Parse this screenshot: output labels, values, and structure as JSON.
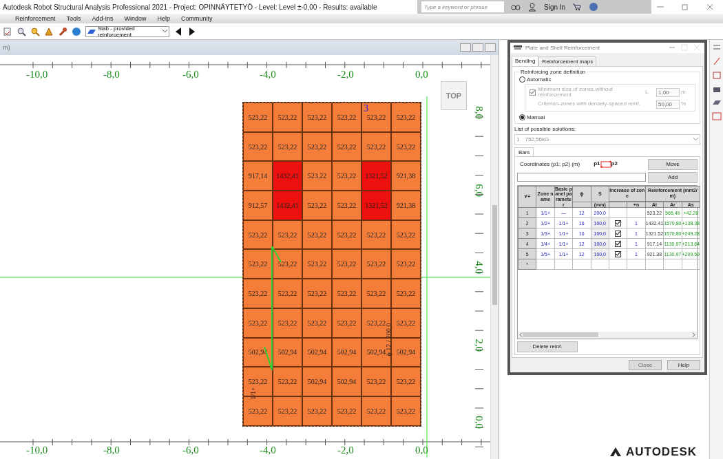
{
  "window": {
    "title": "Autodesk Robot Structural Analysis Professional 2021 - Project: OPINNÄYTETYÖ - Level: Level ±-0,00 - Results: available",
    "search_placeholder": "Type a keyword or phrase",
    "sign_in": "Sign In"
  },
  "menu": [
    "Reinforcement",
    "Tools",
    "Add-Ins",
    "Window",
    "Help",
    "Community"
  ],
  "toolbar": {
    "view_select": "Slab - provided reinforcement"
  },
  "canvas": {
    "title_fragment": "m)",
    "view_cube": "TOP",
    "marker": "3",
    "zone_label": "1/1+",
    "dimension_label": "ϕ 12 / 200,0",
    "top_axis": [
      "-10,0",
      "-8,0",
      "-6,0",
      "-4,0",
      "-2,0",
      "0,0"
    ],
    "bottom_axis": [
      "-10,0",
      "-8,0",
      "-6,0",
      "-4,0",
      "-2,0",
      "0,0"
    ],
    "right_axis": [
      "8,0",
      "6,0",
      "4,0",
      "2,0",
      "0,0"
    ],
    "rows": [
      [
        {
          "value": "523,22",
          "highlighted": false
        },
        {
          "value": "523,22",
          "highlighted": false
        },
        {
          "value": "523,22",
          "highlighted": false
        },
        {
          "value": "523,22",
          "highlighted": false
        },
        {
          "value": "523,22",
          "highlighted": false
        },
        {
          "value": "523,22",
          "highlighted": false
        }
      ],
      [
        {
          "value": "523,22",
          "highlighted": false
        },
        {
          "value": "523,22",
          "highlighted": false
        },
        {
          "value": "523,22",
          "highlighted": false
        },
        {
          "value": "523,22",
          "highlighted": false
        },
        {
          "value": "523,22",
          "highlighted": false
        },
        {
          "value": "523,22",
          "highlighted": false
        }
      ],
      [
        {
          "value": "917,14",
          "highlighted": false
        },
        {
          "value": "1432,41",
          "highlighted": true
        },
        {
          "value": "523,22",
          "highlighted": false
        },
        {
          "value": "523,22",
          "highlighted": false
        },
        {
          "value": "1321,52",
          "highlighted": true
        },
        {
          "value": "921,38",
          "highlighted": false
        }
      ],
      [
        {
          "value": "912,57",
          "highlighted": false
        },
        {
          "value": "1432,41",
          "highlighted": true
        },
        {
          "value": "523,22",
          "highlighted": false
        },
        {
          "value": "523,22",
          "highlighted": false
        },
        {
          "value": "1321,52",
          "highlighted": true
        },
        {
          "value": "921,38",
          "highlighted": false
        }
      ],
      [
        {
          "value": "523,22",
          "highlighted": false
        },
        {
          "value": "523,22",
          "highlighted": false
        },
        {
          "value": "523,22",
          "highlighted": false
        },
        {
          "value": "523,22",
          "highlighted": false
        },
        {
          "value": "523,22",
          "highlighted": false
        },
        {
          "value": "523,22",
          "highlighted": false
        }
      ],
      [
        {
          "value": "523,22",
          "highlighted": false
        },
        {
          "value": "523,22",
          "highlighted": false
        },
        {
          "value": "523,22",
          "highlighted": false
        },
        {
          "value": "523,22",
          "highlighted": false
        },
        {
          "value": "523,22",
          "highlighted": false
        },
        {
          "value": "523,22",
          "highlighted": false
        }
      ],
      [
        {
          "value": "523,22",
          "highlighted": false
        },
        {
          "value": "523,22",
          "highlighted": false
        },
        {
          "value": "523,22",
          "highlighted": false
        },
        {
          "value": "523,22",
          "highlighted": false
        },
        {
          "value": "523,22",
          "highlighted": false
        },
        {
          "value": "523,22",
          "highlighted": false
        }
      ],
      [
        {
          "value": "523,22",
          "highlighted": false
        },
        {
          "value": "523,22",
          "highlighted": false
        },
        {
          "value": "523,22",
          "highlighted": false
        },
        {
          "value": "523,22",
          "highlighted": false
        },
        {
          "value": "523,22",
          "highlighted": false
        },
        {
          "value": "523,22",
          "highlighted": false
        }
      ],
      [
        {
          "value": "502,94",
          "highlighted": false
        },
        {
          "value": "502,94",
          "highlighted": false
        },
        {
          "value": "502,94",
          "highlighted": false
        },
        {
          "value": "502,94",
          "highlighted": false
        },
        {
          "value": "502,94",
          "highlighted": false
        },
        {
          "value": "502,94",
          "highlighted": false
        }
      ],
      [
        {
          "value": "523,22",
          "highlighted": false
        },
        {
          "value": "523,22",
          "highlighted": false
        },
        {
          "value": "502,94",
          "highlighted": false
        },
        {
          "value": "502,94",
          "highlighted": false
        },
        {
          "value": "523,22",
          "highlighted": false
        },
        {
          "value": "523,22",
          "highlighted": false
        }
      ],
      [
        {
          "value": "523,22",
          "highlighted": false
        },
        {
          "value": "523,22",
          "highlighted": false
        },
        {
          "value": "523,22",
          "highlighted": false
        },
        {
          "value": "523,22",
          "highlighted": false
        },
        {
          "value": "523,22",
          "highlighted": false
        },
        {
          "value": "523,22",
          "highlighted": false
        }
      ]
    ]
  },
  "dialog": {
    "title": "Plate and Shell Reinforcement",
    "tabs": [
      {
        "label": "Bending",
        "selected": true
      },
      {
        "label": "Reinforcement maps",
        "selected": false
      }
    ],
    "zone_group": "Reinforcing zone definition",
    "automatic": {
      "label": "Automatic",
      "selected": false
    },
    "min_size": {
      "label": "Minimum size of zones without reinforcement",
      "checked": true,
      "symbol": "L",
      "value": "1,00",
      "unit": "m"
    },
    "criterion": {
      "label": "Criterion-zones with densely-spaced reinf.",
      "value": "50,00",
      "unit": "%"
    },
    "manual": {
      "label": "Manual",
      "selected": true
    },
    "solutions_label": "List of possible solutions:",
    "solution": {
      "index": "1",
      "value": "752,56kG"
    },
    "bars_tab": "Bars",
    "coords_label": "Coordinates (p1; p2) (m)",
    "p1": "p1",
    "p2": "p2",
    "move": "Move",
    "add": "Add",
    "table": {
      "head": {
        "num": "Y+",
        "zone": "Zone name",
        "basic": "Basic panel parameter",
        "phi": "ϕ",
        "s": "S",
        "increase": "Increase of zone",
        "reinf": "Reinforcement (mm2/m)",
        "s_unit": "(mm)",
        "n": "+n",
        "at": "At",
        "ar": "Ar",
        "as": "As"
      },
      "rows": [
        {
          "kind": "base",
          "num": "1",
          "zone": "1/1+",
          "basic": "—",
          "phi": "12",
          "s": "200,0",
          "n": "",
          "at": "523.22",
          "ar": "565,49",
          "as": "+42.26"
        },
        {
          "kind": "zone",
          "num": "2",
          "zone": "1/2+",
          "basic": "1/1+",
          "phi": "16",
          "s": "100,0",
          "checked": true,
          "n": "1",
          "at": "1432.41",
          "ar": "1570,80",
          "as": "+138.38"
        },
        {
          "kind": "zone",
          "num": "3",
          "zone": "1/3+",
          "basic": "1/1+",
          "phi": "16",
          "s": "100,0",
          "checked": true,
          "n": "1",
          "at": "1321.52",
          "ar": "1570,80",
          "as": "+249.28"
        },
        {
          "kind": "zone",
          "num": "4",
          "zone": "1/4+",
          "basic": "1/1+",
          "phi": "12",
          "s": "100,0",
          "checked": true,
          "n": "1",
          "at": "917.14",
          "ar": "1130,97",
          "as": "+213.84"
        },
        {
          "kind": "zone",
          "num": "5",
          "zone": "1/5+",
          "basic": "1/1+",
          "phi": "12",
          "s": "100,0",
          "checked": true,
          "n": "1",
          "at": "921.38",
          "ar": "1130,97",
          "as": "+209.59"
        }
      ],
      "new_row": "*"
    },
    "delete": "Delete reinf.",
    "close": {
      "label": "Close",
      "disabled": true
    },
    "help": "Help"
  },
  "brand": "AUTODESK"
}
